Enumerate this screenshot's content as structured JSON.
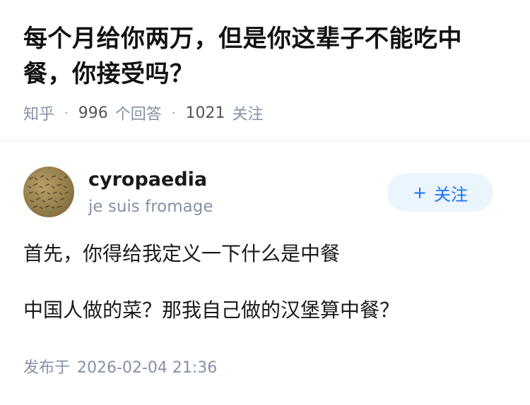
{
  "question": {
    "title": "每个月给你两万，但是你这辈子不能吃中餐，你接受吗？",
    "source": "知乎",
    "answer_count": "996",
    "answer_label": "个回答",
    "follower_count": "1021",
    "follower_label": "关注"
  },
  "author": {
    "name": "cyropaedia",
    "bio": "je suis fromage",
    "avatar_icon": "cuneiform-tablet-avatar",
    "follow_label": "关注"
  },
  "answer": {
    "paragraphs": [
      "首先，你得给我定义一下什么是中餐",
      "中国人做的菜？那我自己做的汉堡算中餐？"
    ],
    "published_label": "发布于",
    "published_time": "2026-02-04 21:36"
  },
  "colors": {
    "accent": "#1772f6",
    "follow_bg": "#ebf5fd",
    "meta_gray": "#8590a6"
  }
}
